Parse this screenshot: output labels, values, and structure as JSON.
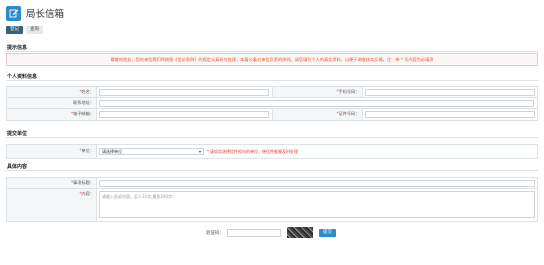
{
  "header": {
    "title": "局长信箱",
    "logo_icon": "edit-icon"
  },
  "tabs": [
    {
      "label": "登记"
    },
    {
      "label": "查询"
    }
  ],
  "sections": {
    "notice": "提示信息",
    "personal": "个人资料信息",
    "unit": "提交单位",
    "content": "具体内容"
  },
  "notice_text": "尊敬的朋友，您的来信我们将按照《信访条例》的规定认真研究处理，本着公着对来信负责的原则。请您填写个人的真实资料，以便于调查核实反馈。注：带 * 号内容为必填项",
  "personal": {
    "name_label": "姓名：",
    "phone_label": "手机号码：",
    "address_label": "联系地址：",
    "email_label": "电子邮箱：",
    "id_label": "证件号码："
  },
  "unit": {
    "unit_label": "单位：",
    "select_value": "请选择单位",
    "hint": "请如实选择信件投向的单位，便信件能够及时处理"
  },
  "content": {
    "subject_label": "事项标题：",
    "body_label": "内容：",
    "body_placeholder": "请输入投诉内容，至少10字,最多240字！"
  },
  "captcha": {
    "label": "验证码：",
    "submit_label": "提交"
  },
  "colors": {
    "accent": "#2e8bcb",
    "tab_active": "#3a5f78",
    "required": "#e03a2a",
    "notice_text": "#e05a2a"
  }
}
